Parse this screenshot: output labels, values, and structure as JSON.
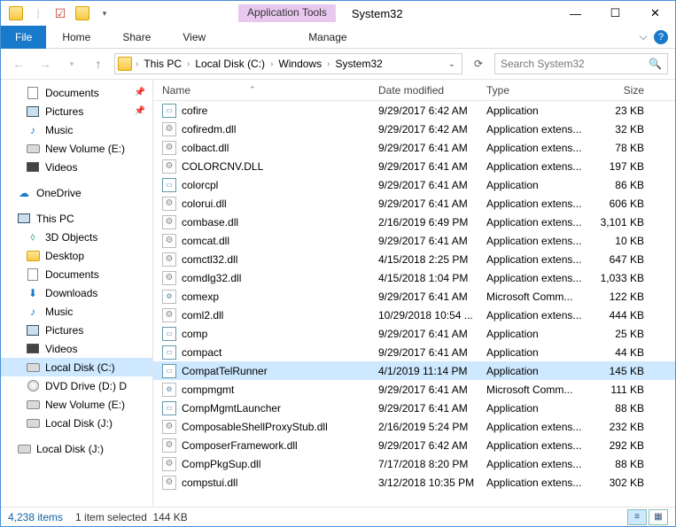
{
  "title": {
    "app_tools": "Application Tools",
    "window": "System32"
  },
  "ribbon": {
    "file": "File",
    "home": "Home",
    "share": "Share",
    "view": "View",
    "manage": "Manage"
  },
  "breadcrumbs": [
    "This PC",
    "Local Disk (C:)",
    "Windows",
    "System32"
  ],
  "search_placeholder": "Search System32",
  "nav": {
    "quick": [
      {
        "label": "Documents",
        "icon": "docs",
        "pinned": true
      },
      {
        "label": "Pictures",
        "icon": "pics",
        "pinned": true
      },
      {
        "label": "Music",
        "icon": "music"
      },
      {
        "label": "New Volume (E:)",
        "icon": "drive"
      },
      {
        "label": "Videos",
        "icon": "vid"
      }
    ],
    "onedrive": "OneDrive",
    "thispc": {
      "label": "This PC",
      "children": [
        {
          "label": "3D Objects",
          "icon": "3d"
        },
        {
          "label": "Desktop",
          "icon": "folder"
        },
        {
          "label": "Documents",
          "icon": "docs"
        },
        {
          "label": "Downloads",
          "icon": "down"
        },
        {
          "label": "Music",
          "icon": "music"
        },
        {
          "label": "Pictures",
          "icon": "pics"
        },
        {
          "label": "Videos",
          "icon": "vid"
        },
        {
          "label": "Local Disk (C:)",
          "icon": "drive",
          "selected": true
        },
        {
          "label": "DVD Drive (D:) D",
          "icon": "dvd"
        },
        {
          "label": "New Volume (E:)",
          "icon": "drive"
        },
        {
          "label": "Local Disk (J:)",
          "icon": "drive"
        }
      ]
    },
    "extra": "Local Disk (J:)"
  },
  "columns": {
    "name": "Name",
    "date": "Date modified",
    "type": "Type",
    "size": "Size"
  },
  "files": [
    {
      "name": "cofire",
      "date": "9/29/2017 6:42 AM",
      "type": "Application",
      "size": "23 KB",
      "ico": "app"
    },
    {
      "name": "cofiredm.dll",
      "date": "9/29/2017 6:42 AM",
      "type": "Application extens...",
      "size": "32 KB",
      "ico": "dll"
    },
    {
      "name": "colbact.dll",
      "date": "9/29/2017 6:41 AM",
      "type": "Application extens...",
      "size": "78 KB",
      "ico": "dll"
    },
    {
      "name": "COLORCNV.DLL",
      "date": "9/29/2017 6:41 AM",
      "type": "Application extens...",
      "size": "197 KB",
      "ico": "dll"
    },
    {
      "name": "colorcpl",
      "date": "9/29/2017 6:41 AM",
      "type": "Application",
      "size": "86 KB",
      "ico": "app"
    },
    {
      "name": "colorui.dll",
      "date": "9/29/2017 6:41 AM",
      "type": "Application extens...",
      "size": "606 KB",
      "ico": "dll"
    },
    {
      "name": "combase.dll",
      "date": "2/16/2019 6:49 PM",
      "type": "Application extens...",
      "size": "3,101 KB",
      "ico": "dll"
    },
    {
      "name": "comcat.dll",
      "date": "9/29/2017 6:41 AM",
      "type": "Application extens...",
      "size": "10 KB",
      "ico": "dll"
    },
    {
      "name": "comctl32.dll",
      "date": "4/15/2018 2:25 PM",
      "type": "Application extens...",
      "size": "647 KB",
      "ico": "dll"
    },
    {
      "name": "comdlg32.dll",
      "date": "4/15/2018 1:04 PM",
      "type": "Application extens...",
      "size": "1,033 KB",
      "ico": "dll"
    },
    {
      "name": "comexp",
      "date": "9/29/2017 6:41 AM",
      "type": "Microsoft Comm...",
      "size": "122 KB",
      "ico": "msc"
    },
    {
      "name": "coml2.dll",
      "date": "10/29/2018 10:54 ...",
      "type": "Application extens...",
      "size": "444 KB",
      "ico": "dll"
    },
    {
      "name": "comp",
      "date": "9/29/2017 6:41 AM",
      "type": "Application",
      "size": "25 KB",
      "ico": "app"
    },
    {
      "name": "compact",
      "date": "9/29/2017 6:41 AM",
      "type": "Application",
      "size": "44 KB",
      "ico": "app"
    },
    {
      "name": "CompatTelRunner",
      "date": "4/1/2019 11:14 PM",
      "type": "Application",
      "size": "145 KB",
      "ico": "app",
      "selected": true
    },
    {
      "name": "compmgmt",
      "date": "9/29/2017 6:41 AM",
      "type": "Microsoft Comm...",
      "size": "111 KB",
      "ico": "msc"
    },
    {
      "name": "CompMgmtLauncher",
      "date": "9/29/2017 6:41 AM",
      "type": "Application",
      "size": "88 KB",
      "ico": "app"
    },
    {
      "name": "ComposableShellProxyStub.dll",
      "date": "2/16/2019 5:24 PM",
      "type": "Application extens...",
      "size": "232 KB",
      "ico": "dll"
    },
    {
      "name": "ComposerFramework.dll",
      "date": "9/29/2017 6:42 AM",
      "type": "Application extens...",
      "size": "292 KB",
      "ico": "dll"
    },
    {
      "name": "CompPkgSup.dll",
      "date": "7/17/2018 8:20 PM",
      "type": "Application extens...",
      "size": "88 KB",
      "ico": "dll"
    },
    {
      "name": "compstui.dll",
      "date": "3/12/2018 10:35 PM",
      "type": "Application extens...",
      "size": "302 KB",
      "ico": "dll"
    }
  ],
  "status": {
    "items": "4,238 items",
    "selected": "1 item selected",
    "size": "144 KB"
  }
}
